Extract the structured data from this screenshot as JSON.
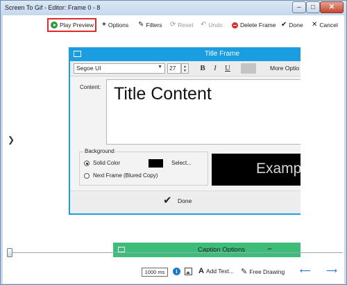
{
  "window": {
    "title": "Screen To Gif - Editor: Frame 0 - 8",
    "min_glyph": "–",
    "max_glyph": "□",
    "close_glyph": "✕"
  },
  "toolbar": {
    "play_preview": "Play Preview",
    "options": "Options",
    "filters": "Filters",
    "reset": "Reset",
    "undo": "Undo",
    "delete_frame": "Delete Frame",
    "done": "Done",
    "cancel": "Cancel"
  },
  "title_frame": {
    "title": "Title Frame",
    "font_family": "Segoe UI",
    "font_size": "27",
    "bold": "B",
    "italic": "I",
    "underline": "U",
    "more_options": "More Optio",
    "content_label": "Content:",
    "content_text": "Title Content",
    "background_label": "Background",
    "solid_color": "Solid Color",
    "select": "Select...",
    "next_frame": "Next Frame (Blured Copy)",
    "example_text": "Examp",
    "done": "Done"
  },
  "caption_options": {
    "title": "Caption Options",
    "collapse": "−"
  },
  "bottom_bar": {
    "delay": "1000 ms",
    "add_text": "Add Text...",
    "free_drawing": "Free Drawing"
  },
  "colors": {
    "dialog_accent": "#1b9de2",
    "caption_accent": "#3dbd79",
    "play_highlight": "#e0292d"
  }
}
